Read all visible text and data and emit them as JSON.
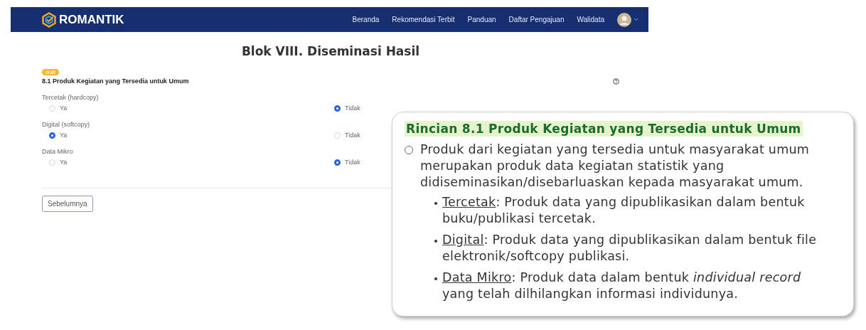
{
  "navbar": {
    "brand": "ROMANTIK",
    "links": [
      "Beranda",
      "Rekomendasi Terbit",
      "Panduan",
      "Daftar Pengajuan",
      "Walidata"
    ]
  },
  "form": {
    "title": "Blok VIII. Diseminasi Hasil",
    "badge": "draft",
    "section": "8.1 Produk Kegiatan yang Tersedia untuk Umum",
    "questions": [
      {
        "label": "Tercetak (hardcopy)",
        "options": [
          {
            "label": "Ya",
            "selected": false
          },
          {
            "label": "Tidak",
            "selected": true
          }
        ]
      },
      {
        "label": "Digital (softcopy)",
        "options": [
          {
            "label": "Ya",
            "selected": true
          },
          {
            "label": "Tidak",
            "selected": false
          }
        ]
      },
      {
        "label": "Data Mikro",
        "options": [
          {
            "label": "Ya",
            "selected": false
          },
          {
            "label": "Tidak",
            "selected": true
          }
        ]
      }
    ],
    "button": "Sebelumnya"
  },
  "callout": {
    "title": "Rincian 8.1 Produk Kegiatan yang Tersedia untuk Umum",
    "text": "Produk dari kegiatan yang tersedia untuk masyarakat umum merupakan produk data kegiatan statistik yang didiseminasikan/disebarluaskan kepada masyarakat umum.",
    "items": [
      {
        "term": "Tercetak",
        "text": ": Produk data yang dipublikasikan dalam bentuk buku/publikasi tercetak."
      },
      {
        "term": "Digital",
        "text": ": Produk data yang dipublikasikan dalam bentuk file elektronik/softcopy publikasi."
      },
      {
        "term": "Data Mikro",
        "text": ": Produk data dalam bentuk *individual record* yang telah dilhilangkan informasi individunya."
      }
    ]
  }
}
